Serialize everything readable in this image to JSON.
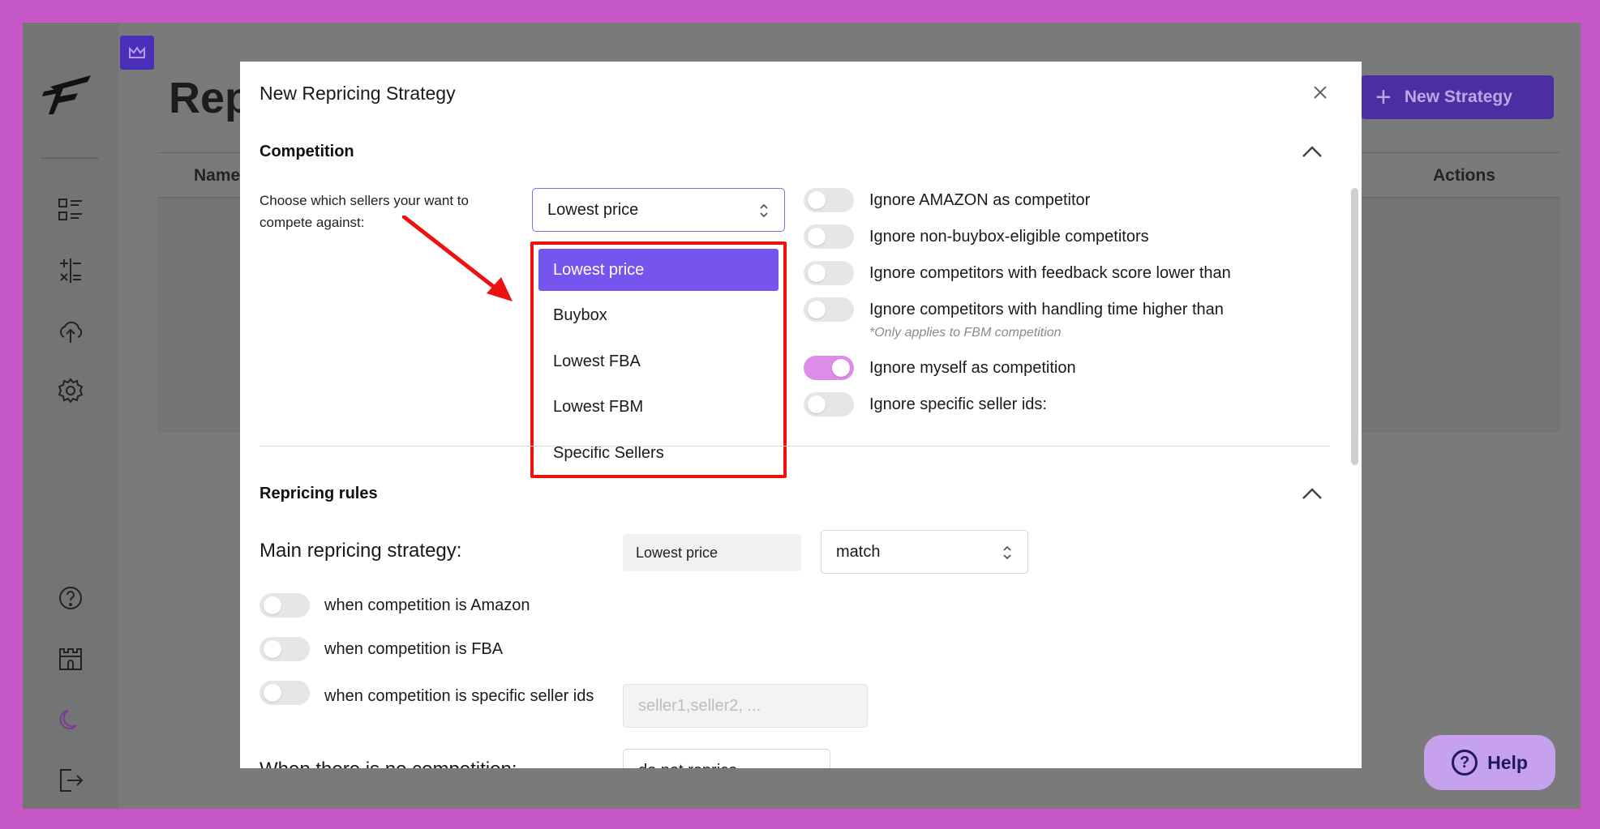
{
  "background_page": {
    "title": "Rep",
    "new_strategy_label": "New Strategy",
    "table_headers": [
      "Name",
      "Actions"
    ]
  },
  "sidebar": {
    "icons": [
      "dashboard-icon",
      "calculator-icon",
      "cloud-upload-icon",
      "settings-icon",
      "help-circle-icon",
      "castle-icon",
      "moon-icon",
      "logout-icon"
    ]
  },
  "modal": {
    "title": "New Repricing Strategy",
    "competition": {
      "section_title": "Competition",
      "choose_label": "Choose which sellers your want to compete against:",
      "selected": "Lowest price",
      "options": [
        "Lowest price",
        "Buybox",
        "Lowest FBA",
        "Lowest FBM",
        "Specific Sellers"
      ],
      "toggles": [
        {
          "label": "Ignore AMAZON as competitor",
          "on": false
        },
        {
          "label": "Ignore non-buybox-eligible competitors",
          "on": false
        },
        {
          "label": "Ignore competitors with feedback score lower than",
          "on": false
        },
        {
          "label": "Ignore competitors with handling time higher than",
          "on": false,
          "note": "*Only applies to FBM competition"
        },
        {
          "label": "Ignore myself as competition",
          "on": true
        },
        {
          "label": "Ignore specific seller ids:",
          "on": false
        }
      ]
    },
    "repricing_rules": {
      "section_title": "Repricing rules",
      "main_label": "Main repricing strategy:",
      "main_value": "Lowest price",
      "main_mode": "match",
      "conditions": [
        {
          "label": "when competition is Amazon",
          "on": false
        },
        {
          "label": "when competition is FBA",
          "on": false
        },
        {
          "label": "when competition is specific seller ids",
          "on": false
        }
      ],
      "seller_ids_placeholder": "seller1,seller2, ...",
      "no_competition_label": "When there is no competition:",
      "no_competition_value": "do not reprice"
    }
  },
  "help_label": "Help",
  "colors": {
    "accent": "#7655ef",
    "toggle_on": "#dd8ce8",
    "highlight_border": "#f01010",
    "frame": "#c657c6"
  }
}
